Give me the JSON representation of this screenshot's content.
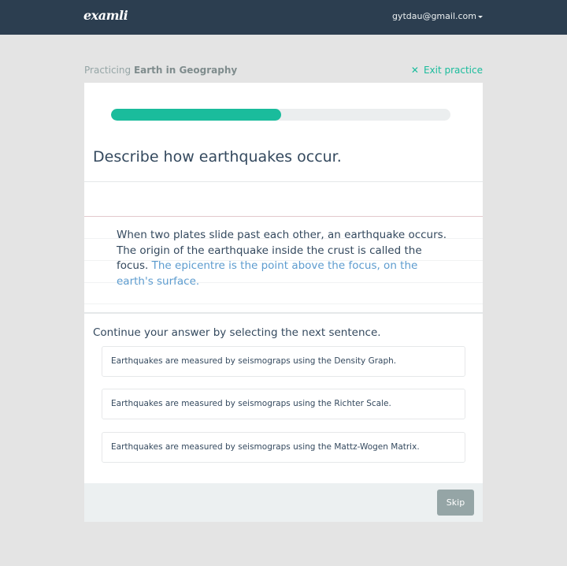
{
  "navbar": {
    "logo": "examli",
    "user_email": "gytdau@gmail.com"
  },
  "header": {
    "practicing_prefix": "Practicing",
    "topic": "Earth in Geography",
    "exit_label": "Exit practice",
    "exit_icon": "✕"
  },
  "progress": {
    "fraction": 0.5
  },
  "question": "Describe how earthquakes occur.",
  "answer": {
    "sentences": [
      "When two plates slide past each other, an earthquake occurs.",
      "The origin of the earthquake inside the crust is called the focus."
    ],
    "highlighted_sentence": "The epicentre is the point above the focus, on the earth's surface."
  },
  "prompt": "Continue your answer by selecting the next sentence.",
  "options": [
    "Earthquakes are measured by seismograps using the Density Graph.",
    "Earthquakes are measured by seismograps using the Richter Scale.",
    "Earthquakes are measured by seismograps using the Mattz-Wogen Matrix."
  ],
  "footer": {
    "skip_label": "Skip"
  },
  "colors": {
    "accent": "#1abc9c",
    "navbar": "#2c3e50",
    "highlight_text": "#5d9ccf"
  }
}
